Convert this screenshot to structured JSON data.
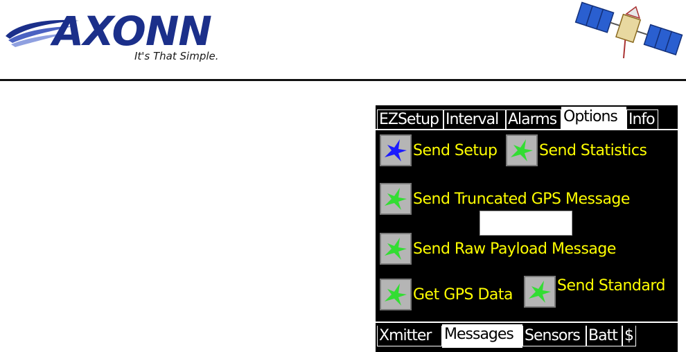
{
  "brand": {
    "name": "AXONN",
    "tagline": "It's That Simple.",
    "logo_color": "#1b2f8a",
    "icon": "satellite-icon"
  },
  "top_tabs": [
    {
      "label": "EZSetup",
      "active": false
    },
    {
      "label": "Interval",
      "active": false
    },
    {
      "label": "Alarms",
      "active": false
    },
    {
      "label": "Options",
      "active": true
    },
    {
      "label": "Info",
      "active": false
    }
  ],
  "buttons": {
    "send_setup": {
      "label": "Send Setup",
      "icon": "satellite-blue-icon"
    },
    "send_statistics": {
      "label": "Send Statistics",
      "icon": "satellite-green-icon"
    },
    "send_truncated_gps": {
      "label": "Send Truncated GPS Message",
      "icon": "satellite-green-icon"
    },
    "send_raw_payload": {
      "label": "Send Raw Payload Message",
      "icon": "satellite-green-icon"
    },
    "get_gps_data": {
      "label": "Get GPS Data",
      "icon": "satellite-green-icon"
    },
    "send_standard": {
      "label": "Send Standard",
      "icon": "satellite-green-icon"
    }
  },
  "payload_field": {
    "value": ""
  },
  "bottom_tabs": [
    {
      "label": "Xmitter",
      "active": false
    },
    {
      "label": "Messages",
      "active": true
    },
    {
      "label": "Sensors",
      "active": false
    },
    {
      "label": "Batt",
      "active": false
    },
    {
      "label": "$",
      "active": false
    }
  ],
  "colors": {
    "screen_bg": "#000000",
    "button_text": "#ffff00",
    "icon_green": "#33dd33",
    "icon_blue": "#1a1aff"
  }
}
